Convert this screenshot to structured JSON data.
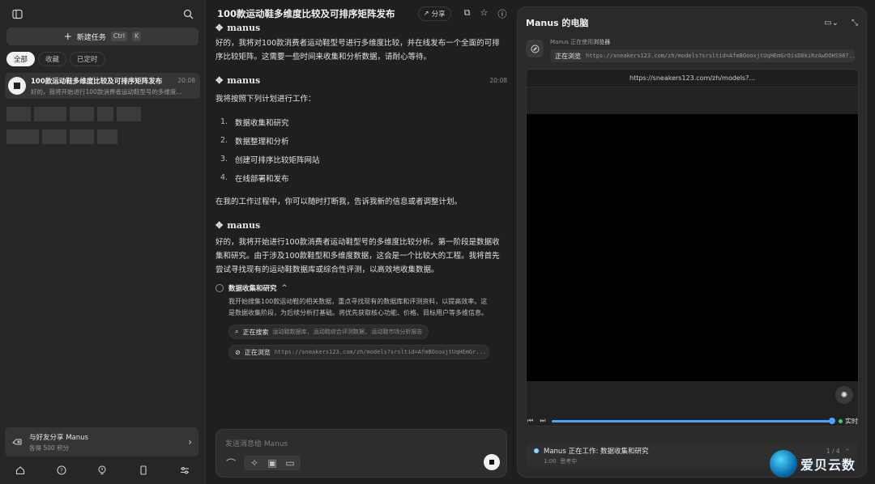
{
  "sidebar": {
    "new_task_label": "新建任务",
    "shortcut_ctrl": "Ctrl",
    "shortcut_key": "K",
    "filters": [
      "全部",
      "收藏",
      "已定时"
    ],
    "task": {
      "title": "100款运动鞋多维度比较及可排序矩阵发布",
      "preview": "好的，我将开始进行100款消费者运动鞋型号的多维度...",
      "time": "20:08"
    },
    "share": {
      "title": "与好友分享 Manus",
      "subtitle": "各得 500 积分"
    }
  },
  "chat": {
    "title": "100款运动鞋多维度比较及可排序矩阵发布",
    "share_label": "分享",
    "agent_name": "manus",
    "msg1": "好的，我将对100款消费者运动鞋型号进行多维度比较，并在线发布一个全面的可排序比较矩阵。这需要一些时间来收集和分析数据，请耐心等待。",
    "msg2_time": "20:08",
    "msg2_intro": "我将按照下列计划进行工作：",
    "plan": [
      {
        "num": "1.",
        "text": "数据收集和研究"
      },
      {
        "num": "2.",
        "text": "数据整理和分析"
      },
      {
        "num": "3.",
        "text": "创建可排序比较矩阵网站"
      },
      {
        "num": "4.",
        "text": "在线部署和发布"
      }
    ],
    "msg2_outro": "在我的工作过程中，你可以随时打断我，告诉我新的信息或者调整计划。",
    "msg3": "好的，我将开始进行100款消费者运动鞋型号的多维度比较分析。第一阶段是数据收集和研究。由于涉及100款鞋型和多维度数据，这会是一个比较大的工程。我将首先尝试寻找现有的运动鞋数据库或综合性评测，以高效地收集数据。",
    "step_title": "数据收集和研究",
    "step_desc": "我开始搜集100款运动鞋的相关数据，重点寻找现有的数据库和评测资料，以提高效率。这是数据收集阶段，为后续分析打基础。将优先获取核心功能、价格、目标用户等多维信息。",
    "action_search_label": "正在搜索",
    "action_search_query": "运动鞋数据库, 运动鞋综合评测数据, 运动鞋市场分析报告",
    "action_browse_label": "正在浏览",
    "action_browse_url": "https://sneakers123.com/zh/models?srsltid=AfmBOooxjtUqHEmGr...",
    "composer_placeholder": "发送消息给 Manus"
  },
  "computer": {
    "title": "Manus 的电脑",
    "status_prefix": "Manus 正在使用",
    "status_tool": "浏览器",
    "browse_label": "正在浏览",
    "browse_url": "https://sneakers123.com/zh/models?srsltid=AfmBOooxjtUqHEmGrOisD0kiRzAwDOHS987...",
    "browser_url": "https://sneakers123.com/zh/models?...",
    "progress_fraction": 1.0,
    "live_label": "实时",
    "work_status": "Manus 正在工作: 数据收集和研究",
    "work_step": "1 / 4",
    "work_time": "1:00",
    "work_sub": "思考中"
  },
  "watermark": "爱贝云数",
  "colors": {
    "accent": "#4aa3ff",
    "live": "#3ccf6e",
    "background": "#1f1f1f"
  }
}
